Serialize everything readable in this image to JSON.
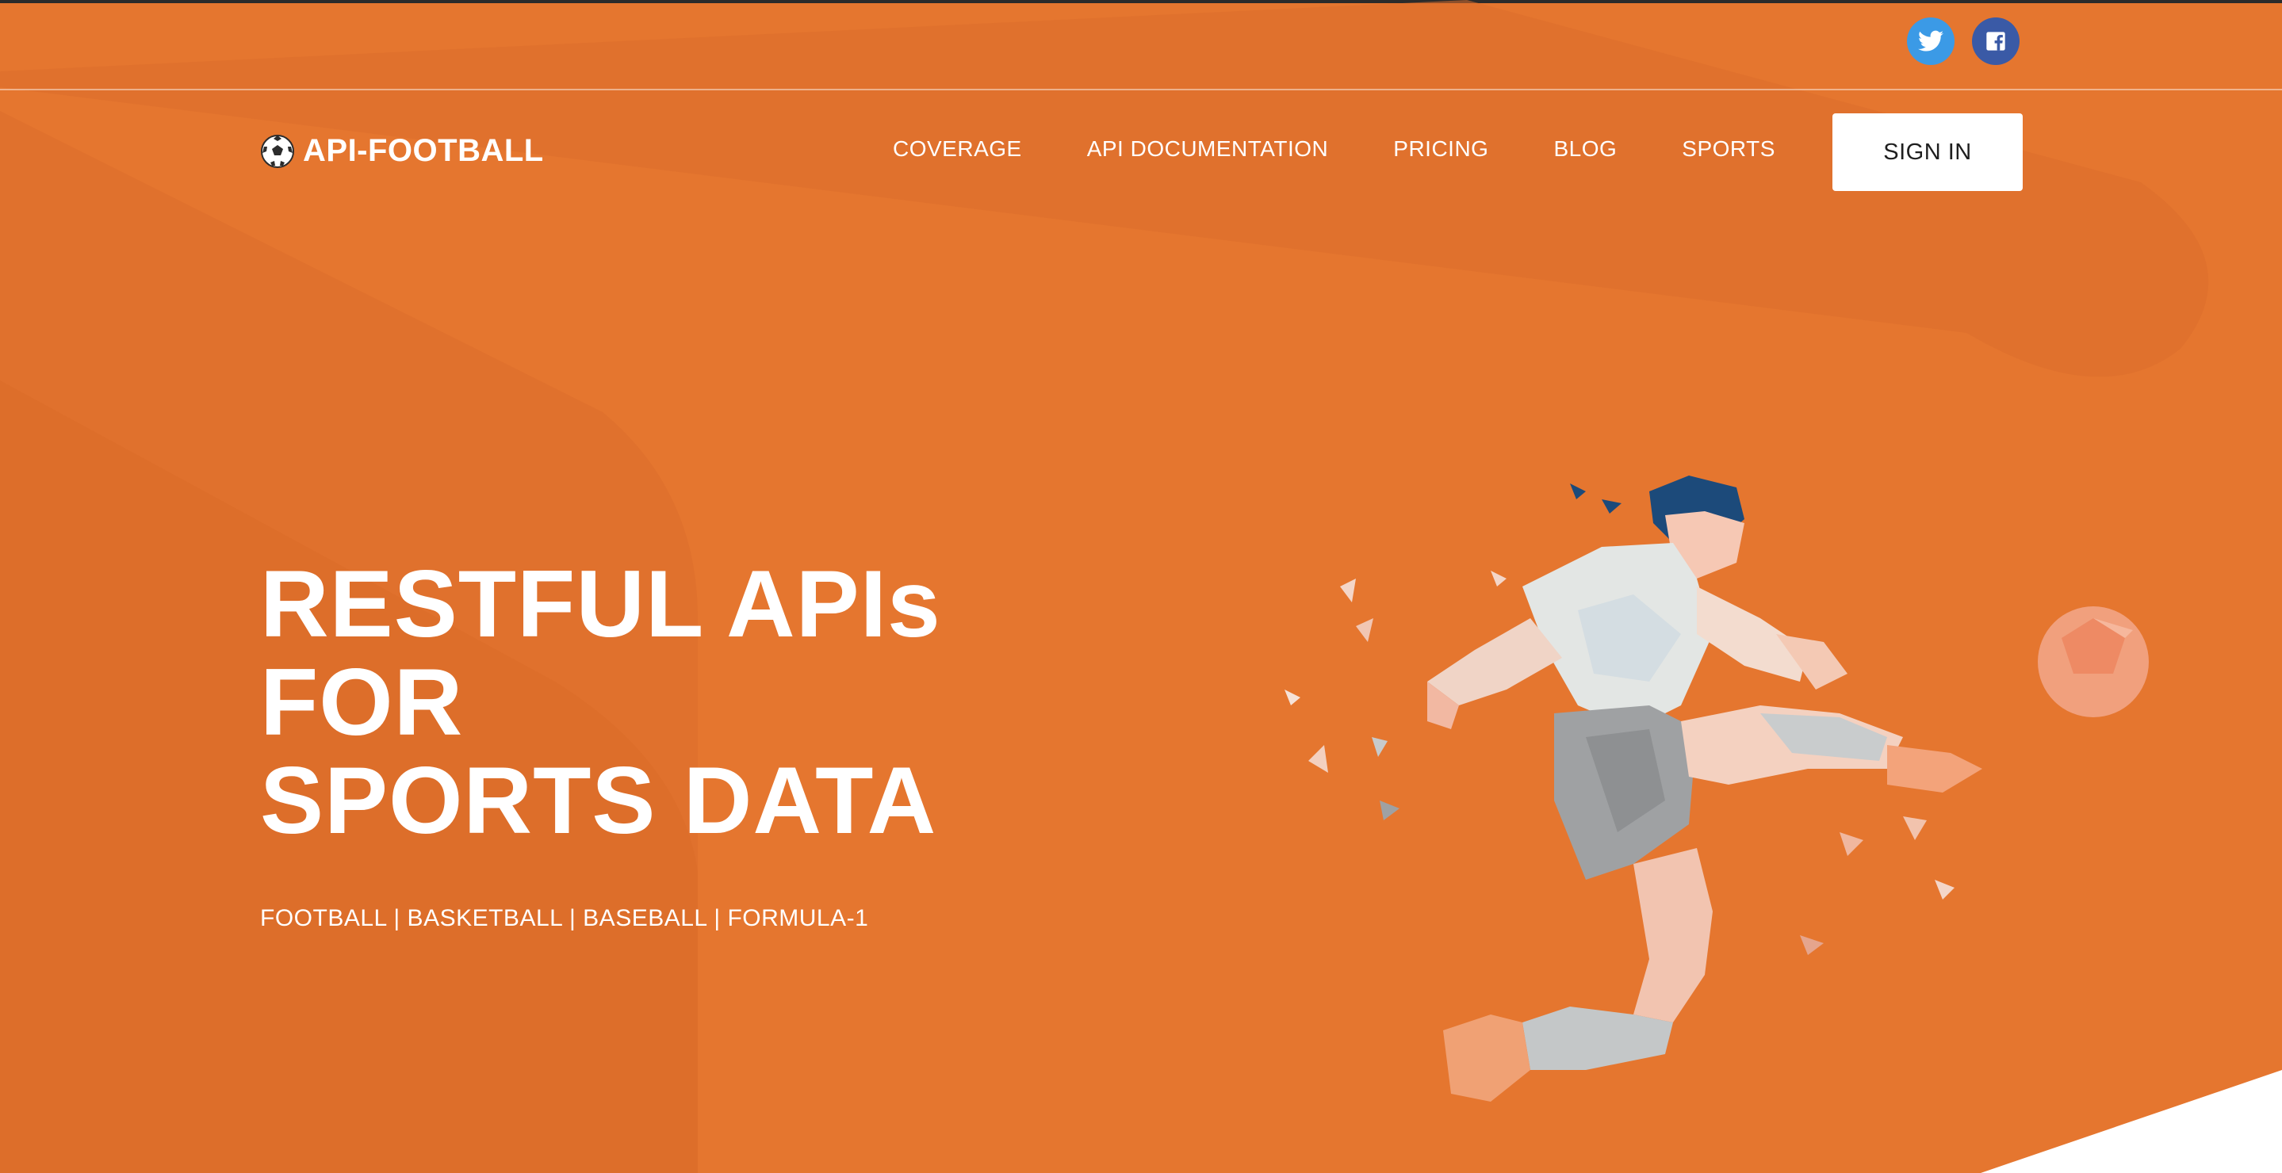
{
  "social": {
    "twitter_icon": "twitter-icon",
    "facebook_icon": "facebook-icon",
    "twitter_color": "#3b9ae6",
    "facebook_color": "#3a5aa6"
  },
  "header": {
    "logo_icon": "soccer-ball-icon",
    "logo_text": "API-FOOTBALL",
    "nav": [
      "COVERAGE",
      "API DOCUMENTATION",
      "PRICING",
      "BLOG",
      "SPORTS"
    ],
    "signin_label": "SIGN IN"
  },
  "hero": {
    "title_line1": "RESTFUL APIs FOR",
    "title_line2": "SPORTS DATA",
    "subtitle": "FOOTBALL | BASKETBALL | BASEBALL | FORMULA-1",
    "illustration": "low-poly-football-player-kicking-ball"
  },
  "colors": {
    "background": "#e5762f",
    "text": "#ffffff",
    "button_bg": "#ffffff",
    "button_text": "#1f1f1f"
  }
}
